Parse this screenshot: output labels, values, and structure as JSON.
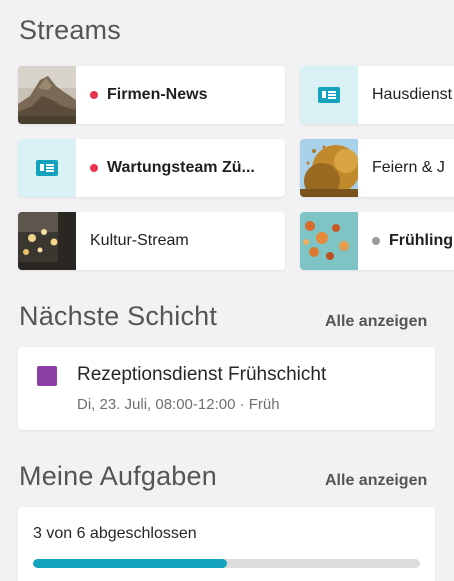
{
  "streams": {
    "title": "Streams",
    "items": [
      {
        "label": "Firmen-News",
        "unread": true,
        "dot_color": "#e8344e",
        "thumb": "mountain-photo"
      },
      {
        "label": "Hausdienst",
        "unread": false,
        "thumb": "news-icon"
      },
      {
        "label": "Wartungsteam Zü...",
        "unread": true,
        "dot_color": "#e8344e",
        "thumb": "news-icon"
      },
      {
        "label": "Feiern & J",
        "unread": false,
        "thumb": "autumn-tree-photo"
      },
      {
        "label": "Kultur-Stream",
        "unread": false,
        "thumb": "lights-photo"
      },
      {
        "label": "Frühling",
        "unread": true,
        "dot_color": "#9a9a9e",
        "thumb": "leaves-photo"
      }
    ]
  },
  "next_shift": {
    "title": "Nächste Schicht",
    "see_all": "Alle anzeigen",
    "shift_title": "Rezeptionsdienst Frühschicht",
    "shift_meta": "Di, 23. Juli, 08:00-12:00 · Früh",
    "color": "#8e3fa6"
  },
  "tasks": {
    "title": "Meine Aufgaben",
    "see_all": "Alle anzeigen",
    "status": "3 von 6 abgeschlossen",
    "completed": 3,
    "total": 6,
    "progress_color": "#14a3bd"
  }
}
